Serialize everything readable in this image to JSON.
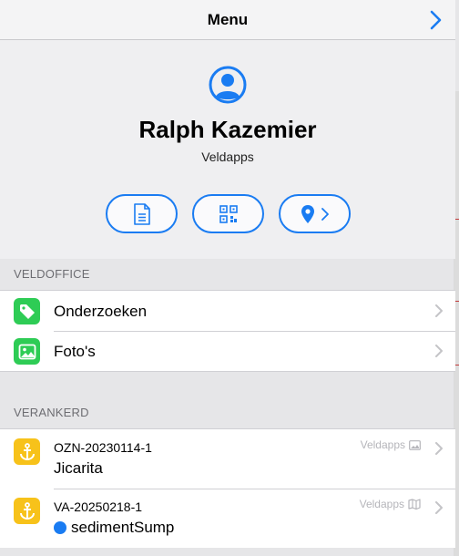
{
  "header": {
    "title": "Menu"
  },
  "profile": {
    "name": "Ralph Kazemier",
    "organization": "Veldapps"
  },
  "actions": [
    {
      "icon": "document-icon"
    },
    {
      "icon": "qr-code-icon"
    },
    {
      "icon": "location-pin-icon"
    }
  ],
  "veldoffice": {
    "label": "VELDOFFICE",
    "items": [
      {
        "label": "Onderzoeken",
        "icon": "tag-icon",
        "color": "#2ecc55"
      },
      {
        "label": "Foto's",
        "icon": "photo-icon",
        "color": "#2ecc55"
      }
    ]
  },
  "verankerd": {
    "label": "VERANKERD",
    "items": [
      {
        "code": "OZN-20230114-1",
        "name": "Jicarita",
        "source": "Veldapps",
        "source_icon": "image-icon"
      },
      {
        "code": "VA-20250218-1",
        "name": "sedimentSump",
        "source": "Veldapps",
        "source_icon": "map-icon",
        "status_color": "#1a7cf2"
      }
    ]
  },
  "colors": {
    "accent": "#1a7cf2",
    "anchor": "#f7c21a",
    "green": "#2ecc55"
  }
}
